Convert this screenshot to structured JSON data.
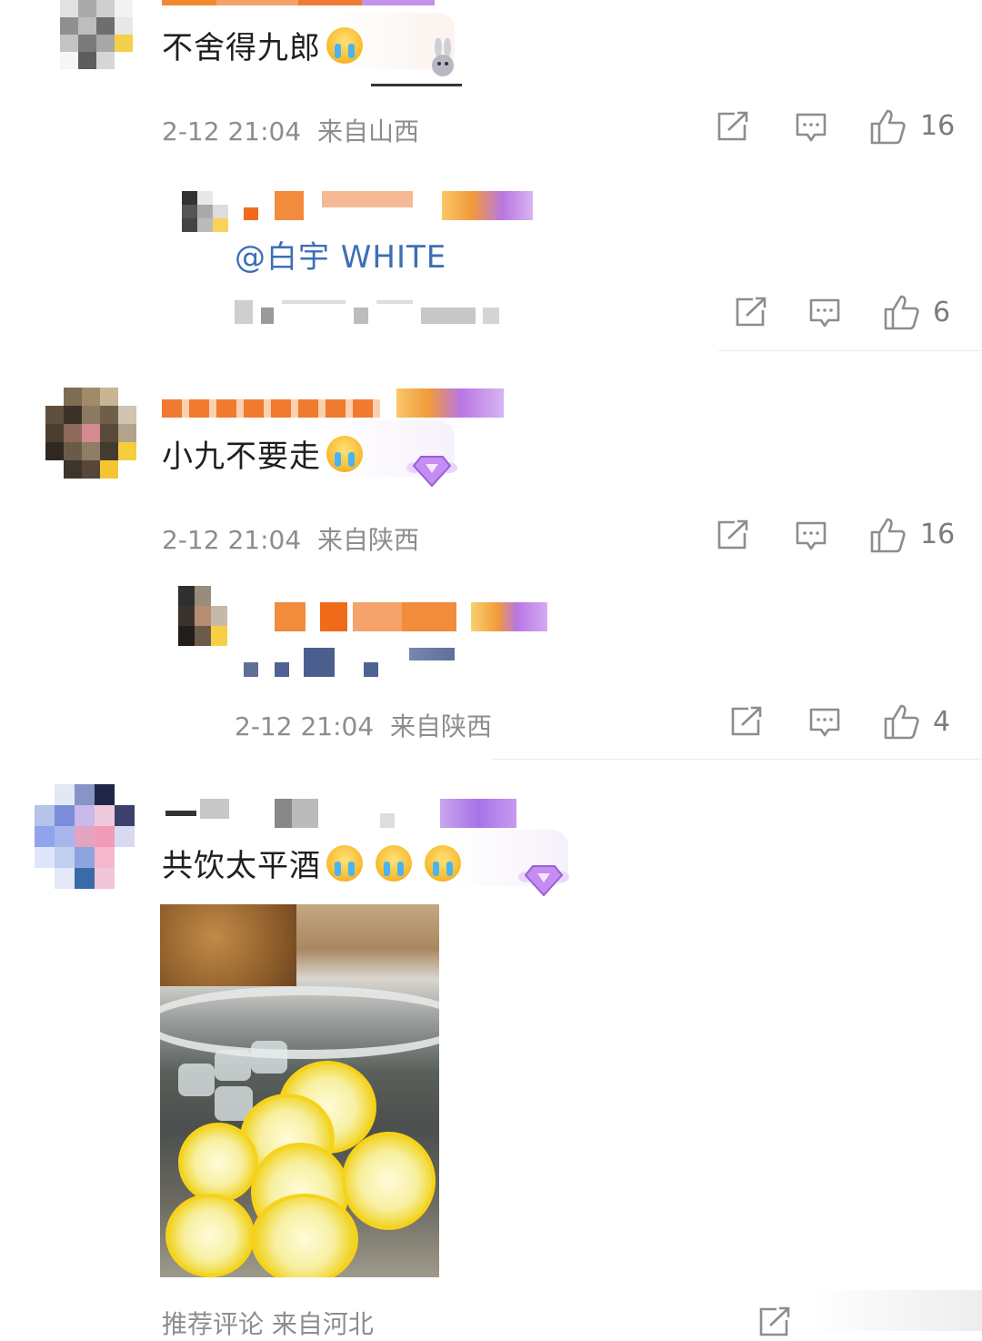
{
  "comments": [
    {
      "text": "不舍得九郎",
      "time": "2-12 21:04",
      "location": "来自山西",
      "likes": "16",
      "reply": {
        "mention": "@白宇 WHITE",
        "likes": "6"
      }
    },
    {
      "text": "小九不要走",
      "time": "2-12 21:04",
      "location": "来自陕西",
      "likes": "16",
      "reply": {
        "time": "2-12 21:04",
        "location": "来自陕西",
        "likes": "4"
      }
    },
    {
      "text": "共饮太平酒",
      "footer": "推荐评论 来自河北"
    }
  ],
  "icons": {
    "share": "share-icon",
    "comment": "comment-icon",
    "like": "thumbs-up-icon",
    "emoji": "crying-face-emoji",
    "badge": "diamond-badge-icon"
  },
  "colors": {
    "meta_text": "#8d8d8d",
    "mention": "#3d6fb6",
    "divider": "#ececec"
  }
}
